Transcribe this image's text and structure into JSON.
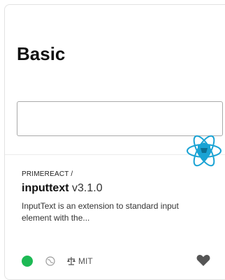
{
  "preview": {
    "title": "Basic",
    "input_value": ""
  },
  "package": {
    "scope": "PRIMEREACT /",
    "name": "inputtext",
    "version": "v3.1.0",
    "description": "InputText is an extension to standard input element with the...",
    "license": "MIT"
  },
  "icons": {
    "logo": "primereact-logo",
    "status": "status-dot",
    "globe": "globe-icon",
    "license": "scale-icon",
    "favorite": "heart-icon"
  },
  "colors": {
    "status": "#1db954",
    "logo": "#1aa3d4",
    "heart": "#555555"
  }
}
